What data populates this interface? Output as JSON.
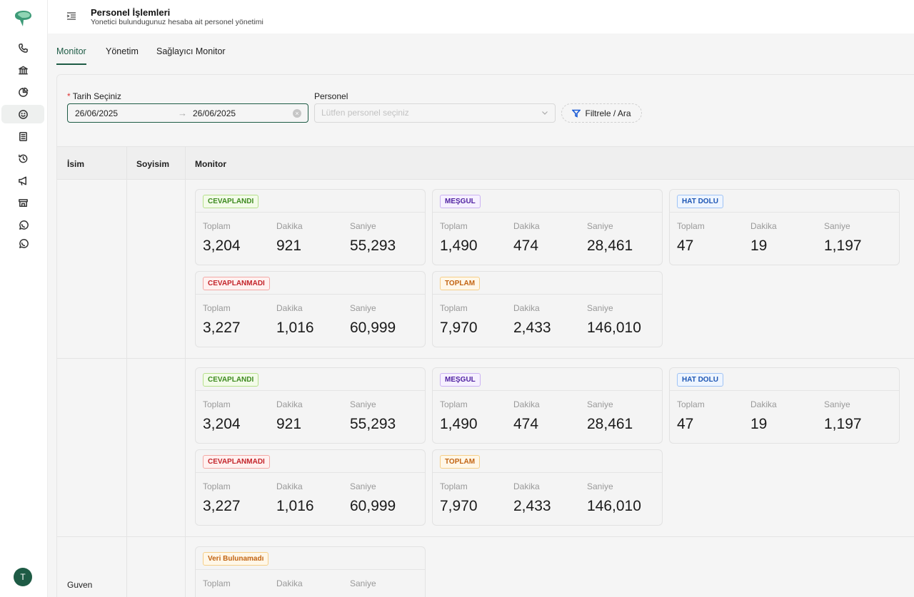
{
  "header": {
    "title": "Personel İşlemleri",
    "subtitle": "Yonetici bulundugunuz hesaba ait personel yönetimi"
  },
  "tabs": [
    {
      "label": "Monitor",
      "active": true
    },
    {
      "label": "Yönetim",
      "active": false
    },
    {
      "label": "Sağlayıcı Monitor",
      "active": false
    }
  ],
  "filters": {
    "date_label": "Tarih Seçiniz",
    "date_required_mark": "*",
    "date_start": "26/06/2025",
    "date_end": "26/06/2025",
    "date_arrow": "→",
    "personnel_label": "Personel",
    "personnel_placeholder": "Lütfen personel seçiniz",
    "filter_button": "Filtrele / Ara"
  },
  "table": {
    "columns": [
      "İsim",
      "Soyisim",
      "Monitor"
    ],
    "stat_labels": {
      "total": "Toplam",
      "minutes": "Dakika",
      "seconds": "Saniye"
    },
    "rows": [
      {
        "name": "",
        "surname": "",
        "cards": [
          {
            "tag": "CEVAPLANDI",
            "color": "green",
            "total": "3,204",
            "minutes": "921",
            "seconds": "55,293"
          },
          {
            "tag": "MEŞGUL",
            "color": "purple",
            "total": "1,490",
            "minutes": "474",
            "seconds": "28,461"
          },
          {
            "tag": "HAT DOLU",
            "color": "blue",
            "total": "47",
            "minutes": "19",
            "seconds": "1,197"
          },
          {
            "tag": "CEVAPLANMADI",
            "color": "red",
            "total": "3,227",
            "minutes": "1,016",
            "seconds": "60,999"
          },
          {
            "tag": "TOPLAM",
            "color": "orange",
            "total": "7,970",
            "minutes": "2,433",
            "seconds": "146,010"
          }
        ]
      },
      {
        "name": "",
        "surname": "",
        "cards": [
          {
            "tag": "CEVAPLANDI",
            "color": "green",
            "total": "3,204",
            "minutes": "921",
            "seconds": "55,293"
          },
          {
            "tag": "MEŞGUL",
            "color": "purple",
            "total": "1,490",
            "minutes": "474",
            "seconds": "28,461"
          },
          {
            "tag": "HAT DOLU",
            "color": "blue",
            "total": "47",
            "minutes": "19",
            "seconds": "1,197"
          },
          {
            "tag": "CEVAPLANMADI",
            "color": "red",
            "total": "3,227",
            "minutes": "1,016",
            "seconds": "60,999"
          },
          {
            "tag": "TOPLAM",
            "color": "orange",
            "total": "7,970",
            "minutes": "2,433",
            "seconds": "146,010"
          }
        ]
      },
      {
        "name": "Guven",
        "surname": "",
        "cards": [
          {
            "tag": "Veri Bulunamadı",
            "color": "orange",
            "total": "",
            "minutes": "",
            "seconds": ""
          }
        ]
      }
    ]
  },
  "user": {
    "avatar_initial": "T"
  },
  "colors": {
    "accent": "#1e5b45",
    "filter_icon": "#1a5bd6"
  }
}
